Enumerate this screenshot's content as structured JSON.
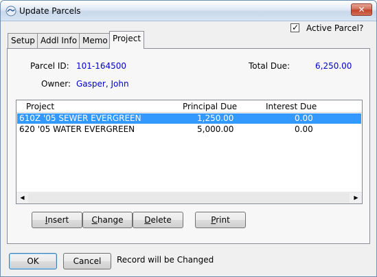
{
  "window": {
    "title": "Update Parcels",
    "close_symbol": "✕",
    "app_icon": "app-icon"
  },
  "active_parcel": {
    "label": "Active Parcel?",
    "checked": true,
    "check_mark": "✓"
  },
  "tabs": [
    {
      "label": "Setup",
      "active": false
    },
    {
      "label": "Addl Info",
      "active": false
    },
    {
      "label": "Memo",
      "active": false
    },
    {
      "label": "Project",
      "active": true
    }
  ],
  "parcel": {
    "id_label": "Parcel ID:",
    "id_value": "101-164500",
    "owner_label": "Owner:",
    "owner_value": "Gasper, John",
    "total_due_label": "Total Due:",
    "total_due_value": "6,250.00"
  },
  "project_list": {
    "columns": [
      "Project",
      "Principal Due",
      "Interest Due"
    ],
    "rows": [
      {
        "project": "610Z '05 SEWER EVERGREEN",
        "principal": "1,250.00",
        "interest": "0.00",
        "selected": true
      },
      {
        "project": "620 '05 WATER EVERGREEN",
        "principal": "5,000.00",
        "interest": "0.00",
        "selected": false
      }
    ],
    "scroll_left": "◀",
    "scroll_right": "▶"
  },
  "list_buttons": {
    "insert_u": "I",
    "insert_rest": "nsert",
    "change_u": "C",
    "change_rest": "hange",
    "delete_u": "D",
    "delete_rest": "elete",
    "print_u": "P",
    "print_rest": "rint"
  },
  "footer": {
    "ok": "OK",
    "cancel": "Cancel",
    "status": "Record will be Changed"
  },
  "colors": {
    "value_text": "#0000c8",
    "selection": "#3399ff"
  }
}
